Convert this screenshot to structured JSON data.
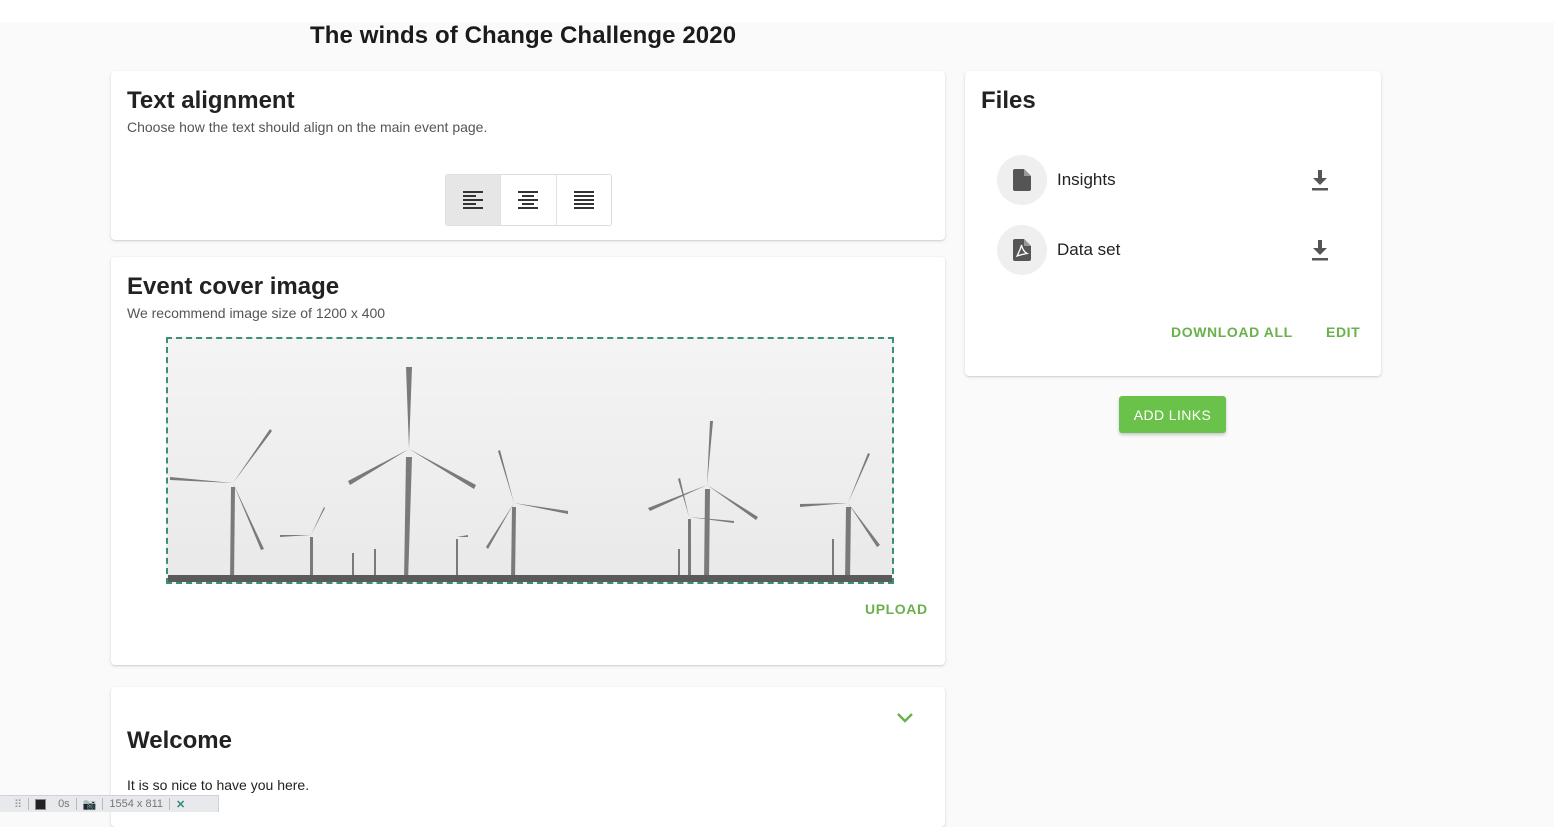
{
  "page": {
    "title": "The winds of Change Challenge 2020"
  },
  "text_alignment": {
    "title": "Text alignment",
    "subtitle": "Choose how the text should align on the main event page.",
    "options": [
      {
        "name": "align-left",
        "active": true
      },
      {
        "name": "align-center",
        "active": false
      },
      {
        "name": "align-justify",
        "active": false
      }
    ]
  },
  "cover": {
    "title": "Event cover image",
    "subtitle": "We recommend image size of 1200 x 400",
    "upload_label": "UPLOAD"
  },
  "welcome": {
    "title": "Welcome",
    "body": "It is so nice to have you here."
  },
  "files": {
    "title": "Files",
    "items": [
      {
        "name": "Insights",
        "icon": "document-icon"
      },
      {
        "name": "Data set",
        "icon": "pdf-icon"
      }
    ],
    "download_all_label": "DOWNLOAD ALL",
    "edit_label": "EDIT"
  },
  "add_links_label": "ADD LINKS",
  "devtools": {
    "time": "0s",
    "size": "1554 x 811"
  },
  "colors": {
    "accent": "#6ab04c",
    "button": "#6ac24b",
    "dashed_border": "#3c8d7a"
  }
}
